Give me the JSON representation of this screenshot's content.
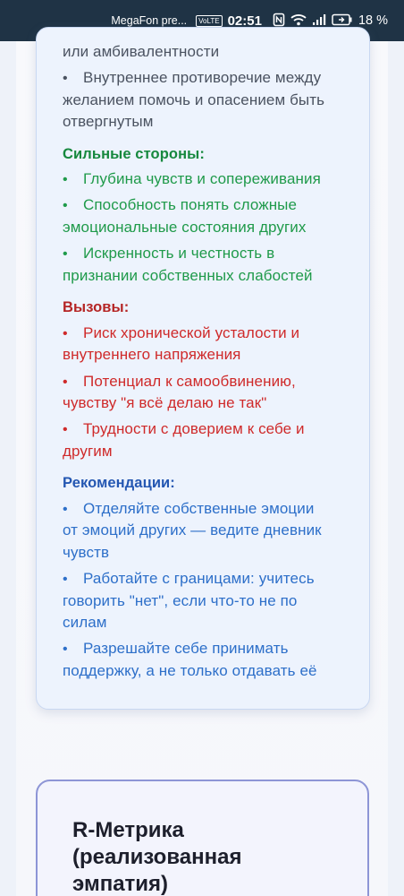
{
  "status_bar": {
    "carrier": "MegaFon pre...",
    "volte": "VoLTE",
    "time": "02:51",
    "battery_percent": "18 %"
  },
  "profile_card": {
    "intro_tail": "или амбивалентности",
    "intro_items": [
      {
        "line1": "Внутреннее противоречие между",
        "line2": "желанием помочь и опасением быть",
        "line3": "отвергнутым"
      }
    ],
    "strengths": {
      "heading": "Сильные стороны:",
      "items": [
        {
          "line1": "Глубина чувств и сопереживания"
        },
        {
          "line1": "Способность понять сложные",
          "line2": "эмоциональные состояния других"
        },
        {
          "line1": "Искренность и честность в",
          "line2": "признании собственных слабостей"
        }
      ]
    },
    "challenges": {
      "heading": "Вызовы:",
      "items": [
        {
          "line1": "Риск хронической усталости и",
          "line2": "внутреннего напряжения"
        },
        {
          "line1": "Потенциал к самообвинению,",
          "line2": "чувству \"я всё делаю не так\""
        },
        {
          "line1": "Трудности с доверием к себе и",
          "line2": "другим"
        }
      ]
    },
    "recommendations": {
      "heading": "Рекомендации:",
      "items": [
        {
          "line1": "Отделяйте собственные эмоции",
          "line2": "от эмоций других — ведите дневник",
          "line3": "чувств"
        },
        {
          "line1": "Работайте с границами: учитесь",
          "line2": "говорить \"нет\", если что-то не по",
          "line3": "силам"
        },
        {
          "line1": "Разрешайте себе принимать",
          "line2": "поддержку, а не только отдавать её"
        }
      ]
    }
  },
  "metric_card": {
    "title_line1": "R-Метрика",
    "title_line2": "(реализованная",
    "title_line3": "эмпатия)"
  },
  "colors": {
    "status_bar": "#1f3345",
    "strengths": "#1f9a4a",
    "challenges": "#cf2a2a",
    "recommendations": "#2d6fc9",
    "card_bg": "#edf3fd",
    "metric_border": "#8d95d6"
  }
}
